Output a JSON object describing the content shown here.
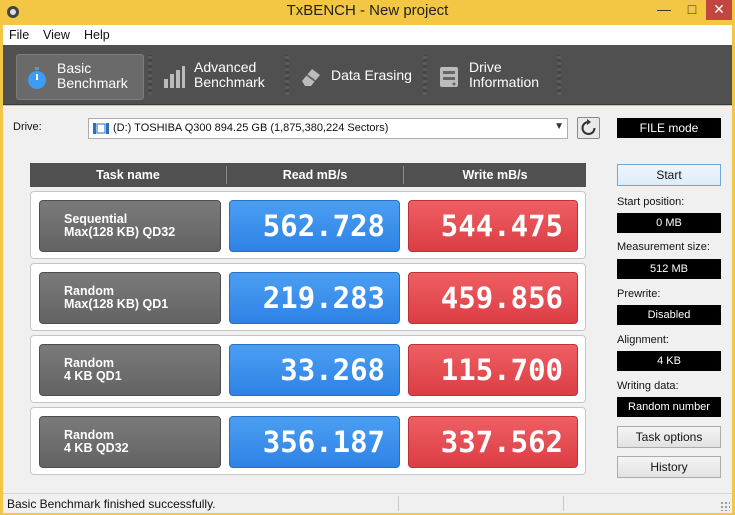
{
  "window": {
    "title": "TxBENCH - New project",
    "minimize_glyph": "—",
    "maximize_glyph": "□",
    "close_glyph": "✕"
  },
  "menu": [
    "File",
    "View",
    "Help"
  ],
  "tabs": [
    {
      "label": "Basic\nBenchmark",
      "icon": "stopwatch-icon",
      "active": true
    },
    {
      "label": "Advanced\nBenchmark",
      "icon": "bar-chart-icon",
      "active": false
    },
    {
      "label": "Data Erasing",
      "icon": "eraser-icon",
      "active": false
    },
    {
      "label": "Drive\nInformation",
      "icon": "drive-info-icon",
      "active": false
    }
  ],
  "drive": {
    "label": "Drive:",
    "selected": "(D:) TOSHIBA Q300  894.25 GB (1,875,380,224 Sectors)",
    "mode": "FILE mode"
  },
  "headers": {
    "task": "Task name",
    "read": "Read mB/s",
    "write": "Write mB/s"
  },
  "results": [
    {
      "task": "Sequential\nMax(128 KB) QD32",
      "read": "562.728",
      "write": "544.475"
    },
    {
      "task": "Random\nMax(128 KB) QD1",
      "read": "219.283",
      "write": "459.856"
    },
    {
      "task": "Random\n4 KB QD1",
      "read": "33.268",
      "write": "115.700"
    },
    {
      "task": "Random\n4 KB QD32",
      "read": "356.187",
      "write": "337.562"
    }
  ],
  "side": {
    "start_label": "Start",
    "start_position_label": "Start position:",
    "start_position": "0 MB",
    "measurement_size_label": "Measurement size:",
    "measurement_size": "512 MB",
    "prewrite_label": "Prewrite:",
    "prewrite": "Disabled",
    "alignment_label": "Alignment:",
    "alignment": "4 KB",
    "writing_data_label": "Writing data:",
    "writing_data": "Random number",
    "task_options_label": "Task options",
    "history_label": "History"
  },
  "status": "Basic Benchmark finished successfully.",
  "colors": {
    "titlebar": "#f3c643",
    "toolbar": "#505050",
    "read": "#2f82e6",
    "write": "#dc3d44",
    "close": "#c0463f"
  }
}
